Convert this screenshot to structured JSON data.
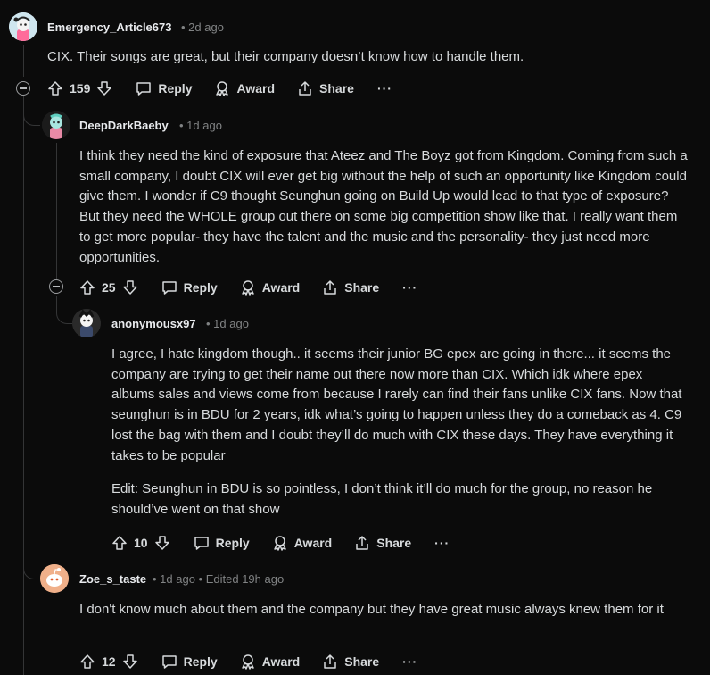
{
  "comments": [
    {
      "username": "Emergency_Article673",
      "time": "2d ago",
      "body": [
        "CIX. Their songs are great, but their company doesn’t know how to handle them."
      ],
      "votes": "159",
      "reply": "Reply",
      "award": "Award",
      "share": "Share",
      "more": "···"
    },
    {
      "username": "DeepDarkBaeby",
      "time": "1d ago",
      "body": [
        "I think they need the kind of exposure that Ateez and The Boyz got from Kingdom. Coming from such a small company, I doubt CIX will ever get big without the help of such an opportunity like Kingdom could give them. I wonder if C9 thought Seunghun going on Build Up would lead to that type of exposure? But they need the WHOLE group out there on some big competition show like that. I really want them to get more popular- they have the talent and the music and the personality- they just need more opportunities."
      ],
      "votes": "25",
      "reply": "Reply",
      "award": "Award",
      "share": "Share",
      "more": "···"
    },
    {
      "username": "anonymousx97",
      "time": "1d ago",
      "body": [
        "I agree, I hate kingdom though.. it seems their junior BG epex are going in there... it seems the company are trying to get their name out there now more than CIX. Which idk where epex albums sales and views come from because I rarely can find their fans unlike CIX fans. Now that seunghun is in BDU for 2 years, idk what’s going to happen unless they do a comeback as 4. C9 lost the bag with them and I doubt they’ll do much with CIX these days. They have everything it takes to be popular",
        "Edit: Seunghun in BDU is so pointless, I don’t think it’ll do much for the group, no reason he should’ve went on that show"
      ],
      "votes": "10",
      "reply": "Reply",
      "award": "Award",
      "share": "Share",
      "more": "···"
    },
    {
      "username": "Zoe_s_taste",
      "time": "1d ago",
      "edited": "Edited 19h ago",
      "body": [
        "I don't know much about them and the company but they have great music always knew them for it"
      ],
      "votes": "12",
      "reply": "Reply",
      "award": "Award",
      "share": "Share",
      "more": "···"
    }
  ],
  "colors": {
    "background": "#0b0b0b",
    "text": "#d7dadc",
    "muted": "#818384",
    "thread_line": "#343536",
    "avatar_orange": "#f0b08a"
  },
  "icons": [
    "upvote-icon",
    "downvote-icon",
    "comment-icon",
    "award-icon",
    "share-icon",
    "collapse-icon"
  ]
}
